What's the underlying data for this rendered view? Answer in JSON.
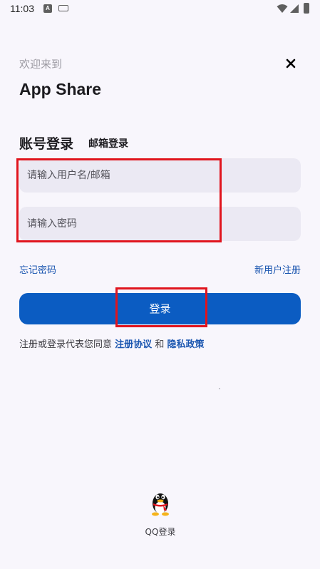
{
  "status_bar": {
    "time": "11:03",
    "notification_icon_letter": "A",
    "icons": [
      "a-notification-icon",
      "keyboard-icon",
      "wifi-icon",
      "signal-icon",
      "battery-icon"
    ]
  },
  "header": {
    "welcome": "欢迎来到",
    "app_name": "App Share",
    "close_icon": "close-icon"
  },
  "tabs": {
    "account": "账号登录",
    "email": "邮箱登录"
  },
  "form": {
    "username_placeholder": "请输入用户名/邮箱",
    "username_value": "",
    "password_placeholder": "请输入密码",
    "password_value": ""
  },
  "links": {
    "forgot_password": "忘记密码",
    "register": "新用户注册"
  },
  "login_button": "登录",
  "agreement": {
    "prefix": "注册或登录代表您同意",
    "terms": "注册协议",
    "and": "和",
    "privacy": "隐私政策"
  },
  "qq_login": {
    "label": "QQ登录",
    "icon": "qq-penguin-icon"
  },
  "colors": {
    "accent": "#0b5cc2",
    "link": "#1b56b0",
    "input_bg": "#ebe9f3",
    "page_bg": "#f8f6fc",
    "highlight": "#e0141d"
  }
}
